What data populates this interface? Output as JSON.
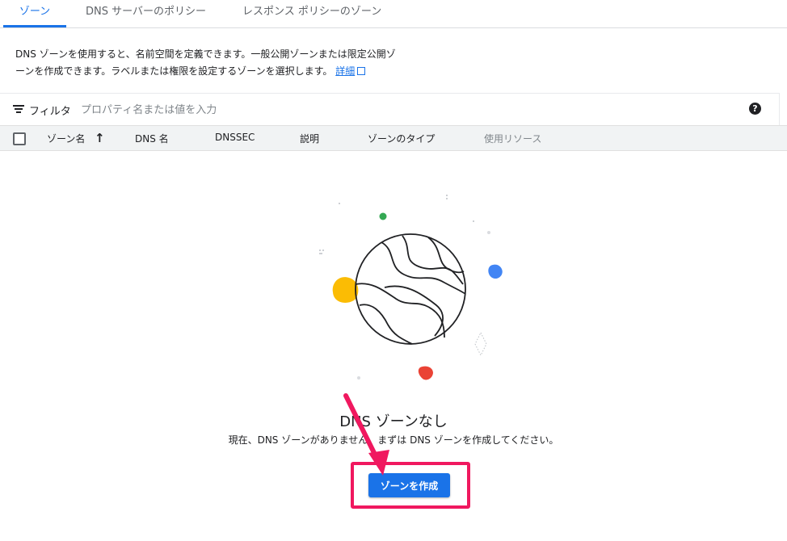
{
  "tabs": [
    {
      "label": "ゾーン",
      "active": true
    },
    {
      "label": "DNS サーバーのポリシー",
      "active": false
    },
    {
      "label": "レスポンス ポリシーのゾーン",
      "active": false
    }
  ],
  "description": {
    "line1": "DNS ゾーンを使用すると、名前空間を定義できます。一般公開ゾーンまたは限定公開ゾ",
    "line2": "ーンを作成できます。ラベルまたは権限を設定するゾーンを選択します。",
    "link": "詳細"
  },
  "filter": {
    "label": "フィルタ",
    "placeholder": "プロパティ名または値を入力"
  },
  "table": {
    "columns": [
      "ゾーン名",
      "DNS 名",
      "DNSSEC",
      "説明",
      "ゾーンのタイプ",
      "使用リソース"
    ],
    "sort_icon": "arrow-up-icon"
  },
  "empty_state": {
    "title": "DNS ゾーンなし",
    "text": "現在、DNS ゾーンがありません。まずは DNS ゾーンを作成してください。",
    "button": "ゾーンを作成"
  },
  "colors": {
    "accent": "#1a73e8",
    "highlight": "#f0185f",
    "yellow": "#fbbc04",
    "green": "#34a853",
    "blue": "#4285f4",
    "red": "#ea4335"
  }
}
